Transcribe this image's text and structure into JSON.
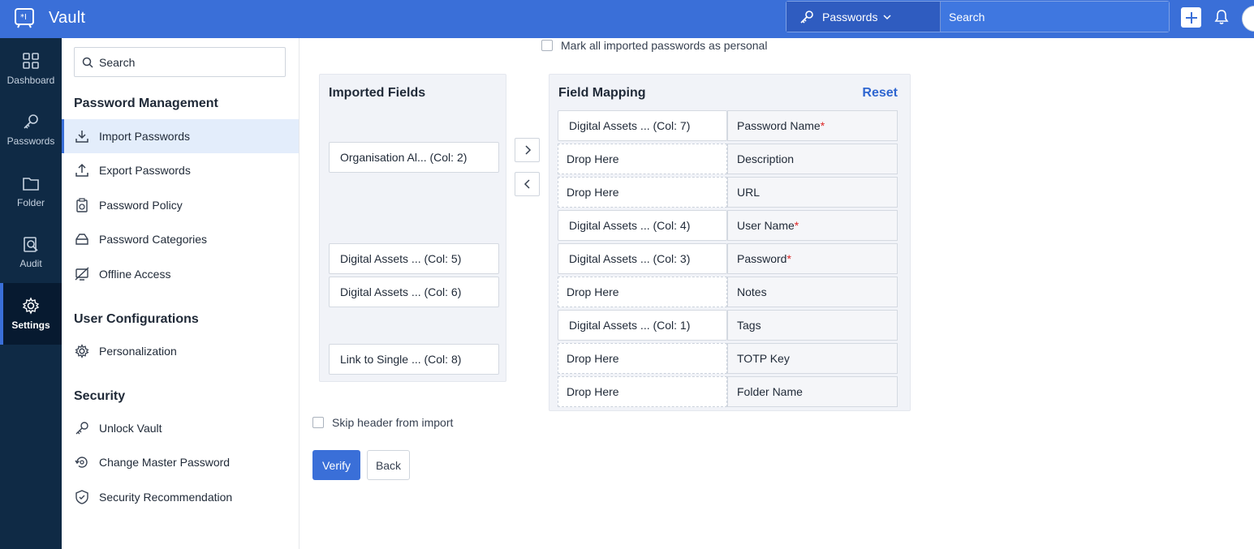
{
  "app": {
    "title": "Vault",
    "logo_icon": "vault-logo-icon"
  },
  "topbar": {
    "scope_label": "Passwords",
    "search_placeholder": "Search",
    "accent": "#3a6fd8"
  },
  "rail": {
    "items": [
      {
        "label": "Dashboard",
        "icon": "dashboard-icon"
      },
      {
        "label": "Passwords",
        "icon": "key-icon"
      },
      {
        "label": "Folder",
        "icon": "folder-icon"
      },
      {
        "label": "Audit",
        "icon": "audit-icon"
      },
      {
        "label": "Settings",
        "icon": "gear-icon",
        "active": true
      }
    ]
  },
  "sidebar": {
    "search_placeholder": "Search",
    "sections": [
      {
        "title": "Password Management",
        "items": [
          {
            "label": "Import Passwords",
            "icon": "import-icon",
            "active": true
          },
          {
            "label": "Export Passwords",
            "icon": "export-icon"
          },
          {
            "label": "Password Policy",
            "icon": "policy-icon"
          },
          {
            "label": "Password Categories",
            "icon": "categories-icon"
          },
          {
            "label": "Offline Access",
            "icon": "offline-icon"
          }
        ]
      },
      {
        "title": "User Configurations",
        "items": [
          {
            "label": "Personalization",
            "icon": "gear-icon"
          }
        ]
      },
      {
        "title": "Security",
        "items": [
          {
            "label": "Unlock Vault",
            "icon": "unlock-key-icon"
          },
          {
            "label": "Change Master Password",
            "icon": "change-password-icon"
          },
          {
            "label": "Security Recommendation",
            "icon": "shield-check-icon"
          }
        ]
      }
    ]
  },
  "main": {
    "mark_all_label": "Mark all imported passwords as personal",
    "imported_fields": {
      "title": "Imported Fields",
      "items": [
        "Organisation Al... (Col: 2)",
        "Digital Assets ... (Col: 5)",
        "Digital Assets ... (Col: 6)",
        "Link to Single ... (Col: 8)"
      ]
    },
    "field_mapping": {
      "title": "Field Mapping",
      "reset_label": "Reset",
      "rows": [
        {
          "source": "Digital Assets ... (Col: 7)",
          "target": "Password Name",
          "required": "*"
        },
        {
          "source": "Drop Here",
          "target": "Description",
          "required": ""
        },
        {
          "source": "Drop Here",
          "target": "URL",
          "required": ""
        },
        {
          "source": "Digital Assets ... (Col: 4)",
          "target": "User Name",
          "required": "*"
        },
        {
          "source": "Digital Assets ... (Col: 3)",
          "target": "Password",
          "required": "*"
        },
        {
          "source": "Drop Here",
          "target": "Notes",
          "required": ""
        },
        {
          "source": "Digital Assets ... (Col: 1)",
          "target": "Tags",
          "required": ""
        },
        {
          "source": "Drop Here",
          "target": "TOTP Key",
          "required": ""
        },
        {
          "source": "Drop Here",
          "target": "Folder Name",
          "required": ""
        }
      ]
    },
    "skip_header_label": "Skip header from import",
    "verify_label": "Verify",
    "back_label": "Back"
  }
}
